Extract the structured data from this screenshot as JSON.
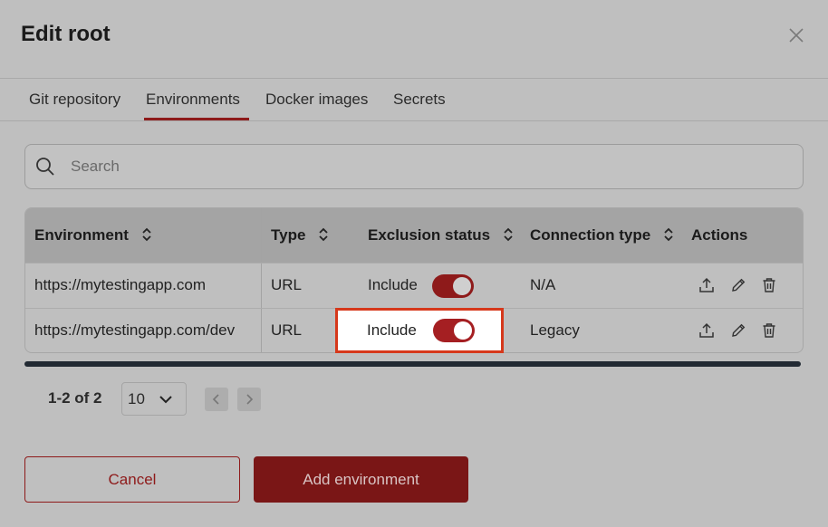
{
  "dialog": {
    "title": "Edit root",
    "close_icon": "close-icon"
  },
  "tabs": [
    {
      "label": "Git repository",
      "active": false
    },
    {
      "label": "Environments",
      "active": true
    },
    {
      "label": "Docker images",
      "active": false
    },
    {
      "label": "Secrets",
      "active": false
    }
  ],
  "search": {
    "placeholder": "Search",
    "value": "",
    "icon": "search-icon"
  },
  "table": {
    "columns": [
      "Environment",
      "Type",
      "Exclusion status",
      "Connection type",
      "Actions"
    ],
    "rows": [
      {
        "environment": "https://mytestingapp.com",
        "type": "URL",
        "exclusion_status": "Include",
        "included": true,
        "connection_type": "N/A"
      },
      {
        "environment": "https://mytestingapp.com/dev",
        "type": "URL",
        "exclusion_status": "Include",
        "included": true,
        "connection_type": "Legacy"
      }
    ],
    "action_icons": [
      "upload-icon",
      "pencil-icon",
      "trash-icon"
    ]
  },
  "pagination": {
    "range": "1-2 of 2",
    "page_size": "10"
  },
  "buttons": {
    "cancel": "Cancel",
    "add": "Add environment"
  },
  "colors": {
    "accent": "#8e1a1a",
    "highlight_border": "#d6381b"
  }
}
